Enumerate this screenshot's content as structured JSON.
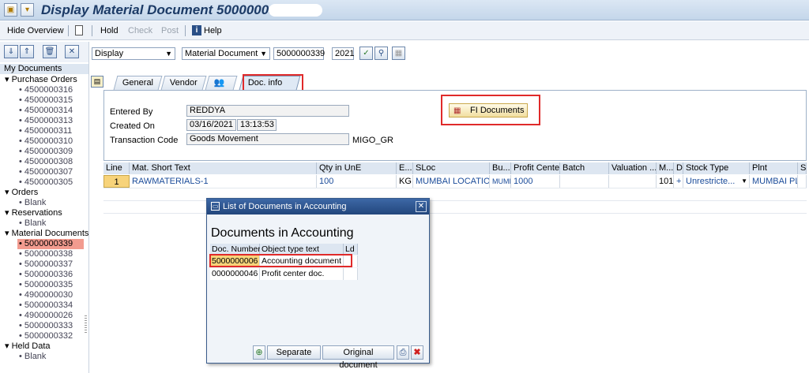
{
  "window": {
    "title": "Display Material Document 5000000339"
  },
  "toolbar": {
    "hide_overview": "Hide Overview",
    "hold": "Hold",
    "check": "Check",
    "post": "Post",
    "help": "Help"
  },
  "left": {
    "header": "My Documents",
    "tree": [
      {
        "text": "▾ Purchase Orders",
        "type": "hdr"
      },
      {
        "text": "• 4500000316",
        "type": "leaf"
      },
      {
        "text": "• 4500000315",
        "type": "leaf"
      },
      {
        "text": "• 4500000314",
        "type": "leaf"
      },
      {
        "text": "• 4500000313",
        "type": "leaf"
      },
      {
        "text": "• 4500000311",
        "type": "leaf"
      },
      {
        "text": "• 4500000310",
        "type": "leaf"
      },
      {
        "text": "• 4500000309",
        "type": "leaf"
      },
      {
        "text": "• 4500000308",
        "type": "leaf"
      },
      {
        "text": "• 4500000307",
        "type": "leaf"
      },
      {
        "text": "• 4500000305",
        "type": "leaf"
      },
      {
        "text": "▾ Orders",
        "type": "hdr"
      },
      {
        "text": "• Blank",
        "type": "leaf"
      },
      {
        "text": "▾ Reservations",
        "type": "hdr"
      },
      {
        "text": "• Blank",
        "type": "leaf"
      },
      {
        "text": "▾ Material Documents",
        "type": "hdr"
      },
      {
        "text": "• 5000000339",
        "type": "sel"
      },
      {
        "text": "• 5000000338",
        "type": "leaf"
      },
      {
        "text": "• 5000000337",
        "type": "leaf"
      },
      {
        "text": "• 5000000336",
        "type": "leaf"
      },
      {
        "text": "• 5000000335",
        "type": "leaf"
      },
      {
        "text": "• 4900000030",
        "type": "leaf"
      },
      {
        "text": "• 5000000334",
        "type": "leaf"
      },
      {
        "text": "• 4900000026",
        "type": "leaf"
      },
      {
        "text": "• 5000000333",
        "type": "leaf"
      },
      {
        "text": "• 5000000332",
        "type": "leaf"
      },
      {
        "text": "▾ Held Data",
        "type": "hdr"
      },
      {
        "text": "• Blank",
        "type": "leaf"
      }
    ]
  },
  "selectors": {
    "action": "Display",
    "doc_type": "Material Document",
    "doc_number": "5000000339",
    "year": "2021"
  },
  "tabs": [
    "General",
    "Vendor",
    "",
    "Doc. info"
  ],
  "docinfo": {
    "entered_by_label": "Entered By",
    "entered_by": "REDDYA",
    "created_on_label": "Created On",
    "created_date": "03/16/2021",
    "created_time": "13:13:53",
    "tcode_label": "Transaction Code",
    "tcode_text": "Goods Movement",
    "tcode": "MIGO_GR",
    "fi_button": "FI Documents"
  },
  "grid": {
    "headers": [
      "Line",
      "Mat. Short Text",
      "Qty in UnE",
      "E...",
      "SLoc",
      "Bu...",
      "Profit Center",
      "Batch",
      "Valuation ...",
      "M...",
      "D",
      "Stock Type",
      "Plnt",
      "S."
    ],
    "row": [
      "1",
      "RAWMATERIALS-1",
      "100",
      "KG",
      "MUMBAI LOCATION",
      "MUMB",
      "1000",
      "",
      "",
      "101",
      "+",
      "Unrestricte...",
      "MUMBAI PL...",
      ""
    ]
  },
  "popup": {
    "title": "List of Documents in Accounting",
    "heading": "Documents in Accounting",
    "headers": [
      "Doc. Number",
      "Object type text",
      "Ld"
    ],
    "rows": [
      {
        "num": "5000000006",
        "text": "Accounting document"
      },
      {
        "num": "0000000046",
        "text": "Profit center doc."
      }
    ],
    "separate_btn": "Separate",
    "original_btn": "Original document"
  },
  "colors": {
    "highlight": "#f29b8f",
    "selected_cell": "#f7d37a",
    "red_callout": "#e02a2a"
  }
}
